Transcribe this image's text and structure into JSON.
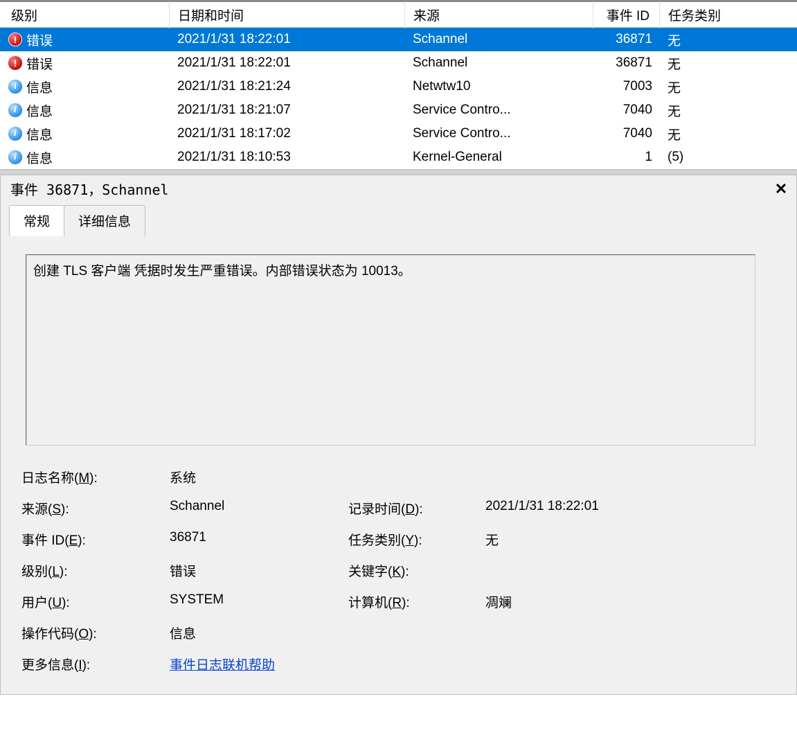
{
  "columns": {
    "level": "级别",
    "datetime": "日期和时间",
    "source": "来源",
    "event_id": "事件 ID",
    "task": "任务类别"
  },
  "rows": [
    {
      "icon": "error",
      "level": "错误",
      "datetime": "2021/1/31 18:22:01",
      "source": "Schannel",
      "event_id": "36871",
      "task": "无",
      "selected": true
    },
    {
      "icon": "error",
      "level": "错误",
      "datetime": "2021/1/31 18:22:01",
      "source": "Schannel",
      "event_id": "36871",
      "task": "无"
    },
    {
      "icon": "info",
      "level": "信息",
      "datetime": "2021/1/31 18:21:24",
      "source": "Netwtw10",
      "event_id": "7003",
      "task": "无"
    },
    {
      "icon": "info",
      "level": "信息",
      "datetime": "2021/1/31 18:21:07",
      "source": "Service Contro...",
      "event_id": "7040",
      "task": "无"
    },
    {
      "icon": "info",
      "level": "信息",
      "datetime": "2021/1/31 18:17:02",
      "source": "Service Contro...",
      "event_id": "7040",
      "task": "无"
    },
    {
      "icon": "info",
      "level": "信息",
      "datetime": "2021/1/31 18:10:53",
      "source": "Kernel-General",
      "event_id": "1",
      "task": "(5)"
    }
  ],
  "detail": {
    "title": "事件 36871，Schannel",
    "tabs": {
      "general": "常规",
      "details": "详细信息"
    },
    "message": "创建 TLS 客户端 凭据时发生严重错误。内部错误状态为 10013。",
    "props": {
      "log_name_label": "日志名称(M):",
      "log_name": "系统",
      "source_label": "来源(S):",
      "source": "Schannel",
      "logged_label": "记录时间(D):",
      "logged": "2021/1/31 18:22:01",
      "eventid_label": "事件 ID(E):",
      "eventid": "36871",
      "task_label": "任务类别(Y):",
      "task": "无",
      "level_label": "级别(L):",
      "level": "错误",
      "keywords_label": "关键字(K):",
      "keywords": "",
      "user_label": "用户(U):",
      "user": "SYSTEM",
      "computer_label": "计算机(R):",
      "computer": "凋斓",
      "opcode_label": "操作代码(O):",
      "opcode": "信息",
      "moreinfo_label": "更多信息(I):",
      "moreinfo_link": "事件日志联机帮助"
    }
  }
}
